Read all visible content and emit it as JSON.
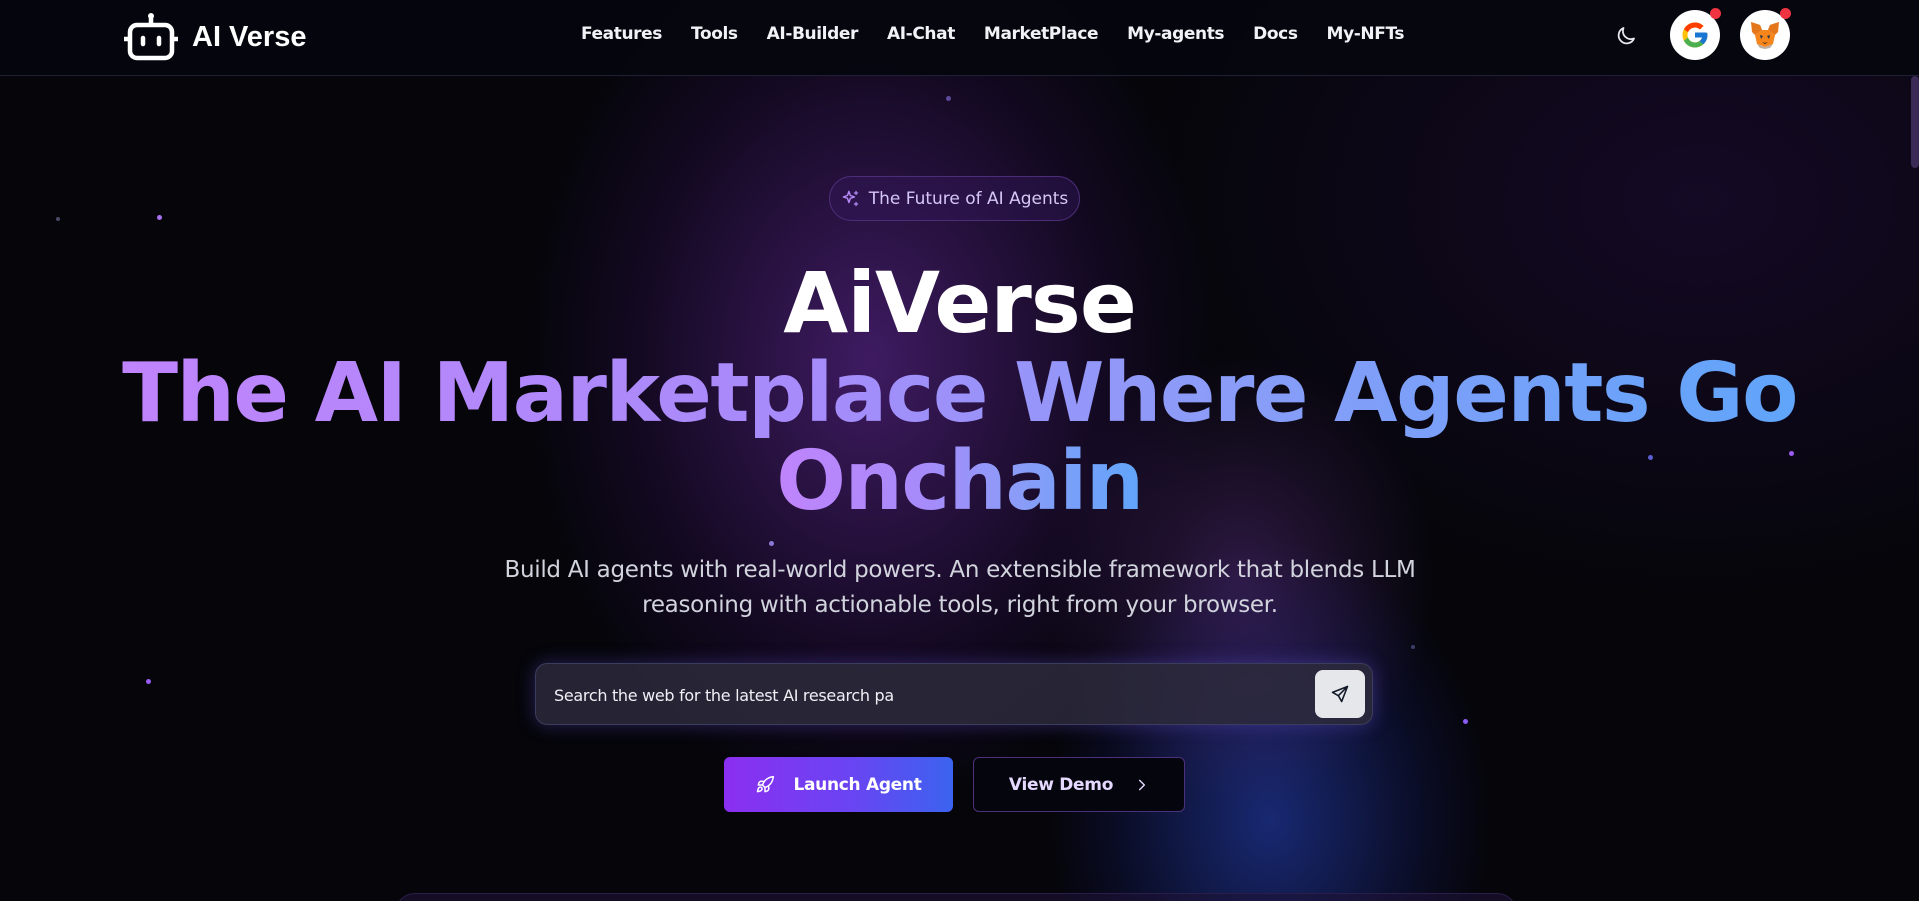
{
  "brand": {
    "name": "AI Verse"
  },
  "nav": {
    "items": [
      "Features",
      "Tools",
      "AI-Builder",
      "AI-Chat",
      "MarketPlace",
      "My-agents",
      "Docs",
      "My-NFTs"
    ]
  },
  "header_actions": {
    "theme_icon": "moon-icon",
    "google_icon": "google-icon",
    "wallet_icon": "metamask-fox-icon"
  },
  "hero": {
    "badge_icon": "sparkles-icon",
    "badge_label": "The Future of AI Agents",
    "title": "AiVerse",
    "subtitle_line1": "The AI Marketplace Where Agents Go",
    "subtitle_line2": "Onchain",
    "description_line1": "Build AI agents with real-world powers. An extensible framework that blends LLM",
    "description_line2": "reasoning with actionable tools, right from your browser."
  },
  "search": {
    "value": "Search the web for the latest AI research pa",
    "send_icon": "send-icon"
  },
  "actions": {
    "launch_label": "Launch Agent",
    "launch_icon": "rocket-icon",
    "demo_label": "View Demo",
    "demo_icon": "chevron-right-icon"
  },
  "colors": {
    "background": "#05050a",
    "accent_purple": "#8b2ff0",
    "accent_blue": "#3b63f0",
    "gradient_start": "#c084fc",
    "gradient_end": "#60a5fa",
    "notification_dot": "#ef3340"
  }
}
